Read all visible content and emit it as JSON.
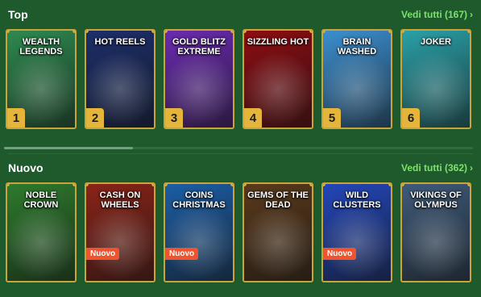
{
  "top": {
    "title": "Top",
    "see_all": "Vedi tutti (167)",
    "games": [
      {
        "title": "Wealth Legends",
        "rank": "1",
        "bg": "#2e8a4f"
      },
      {
        "title": "Hot Reels",
        "rank": "2",
        "bg": "#1d2f6b"
      },
      {
        "title": "Gold Blitz Extreme",
        "rank": "3",
        "bg": "#6a2bb0"
      },
      {
        "title": "Sizzling Hot",
        "rank": "4",
        "bg": "#8d0d12"
      },
      {
        "title": "Brain Washed",
        "rank": "5",
        "bg": "#3c8fd0"
      },
      {
        "title": "Joker",
        "rank": "6",
        "bg": "#2aa1a8"
      }
    ]
  },
  "nuovo": {
    "title": "Nuovo",
    "see_all": "Vedi tutti (362)",
    "badge_label": "Nuovo",
    "games": [
      {
        "title": "Noble Crown",
        "badge": false,
        "bg": "#2e7b2d"
      },
      {
        "title": "Cash on Wheels",
        "badge": true,
        "bg": "#8a2418"
      },
      {
        "title": "Coins Christmas",
        "badge": true,
        "bg": "#1c5ea6"
      },
      {
        "title": "Gems of the Dead",
        "badge": false,
        "bg": "#5a3a1c"
      },
      {
        "title": "Wild Clusters",
        "badge": true,
        "bg": "#2347b9"
      },
      {
        "title": "Vikings of Olympus",
        "badge": false,
        "bg": "#3f5b7a"
      }
    ]
  },
  "colors": {
    "background": "#1f5a2c",
    "accent": "#7be36a",
    "card_border": "#c9a43a",
    "rank_badge": "#e5b53b",
    "new_badge": "#f0542f"
  }
}
